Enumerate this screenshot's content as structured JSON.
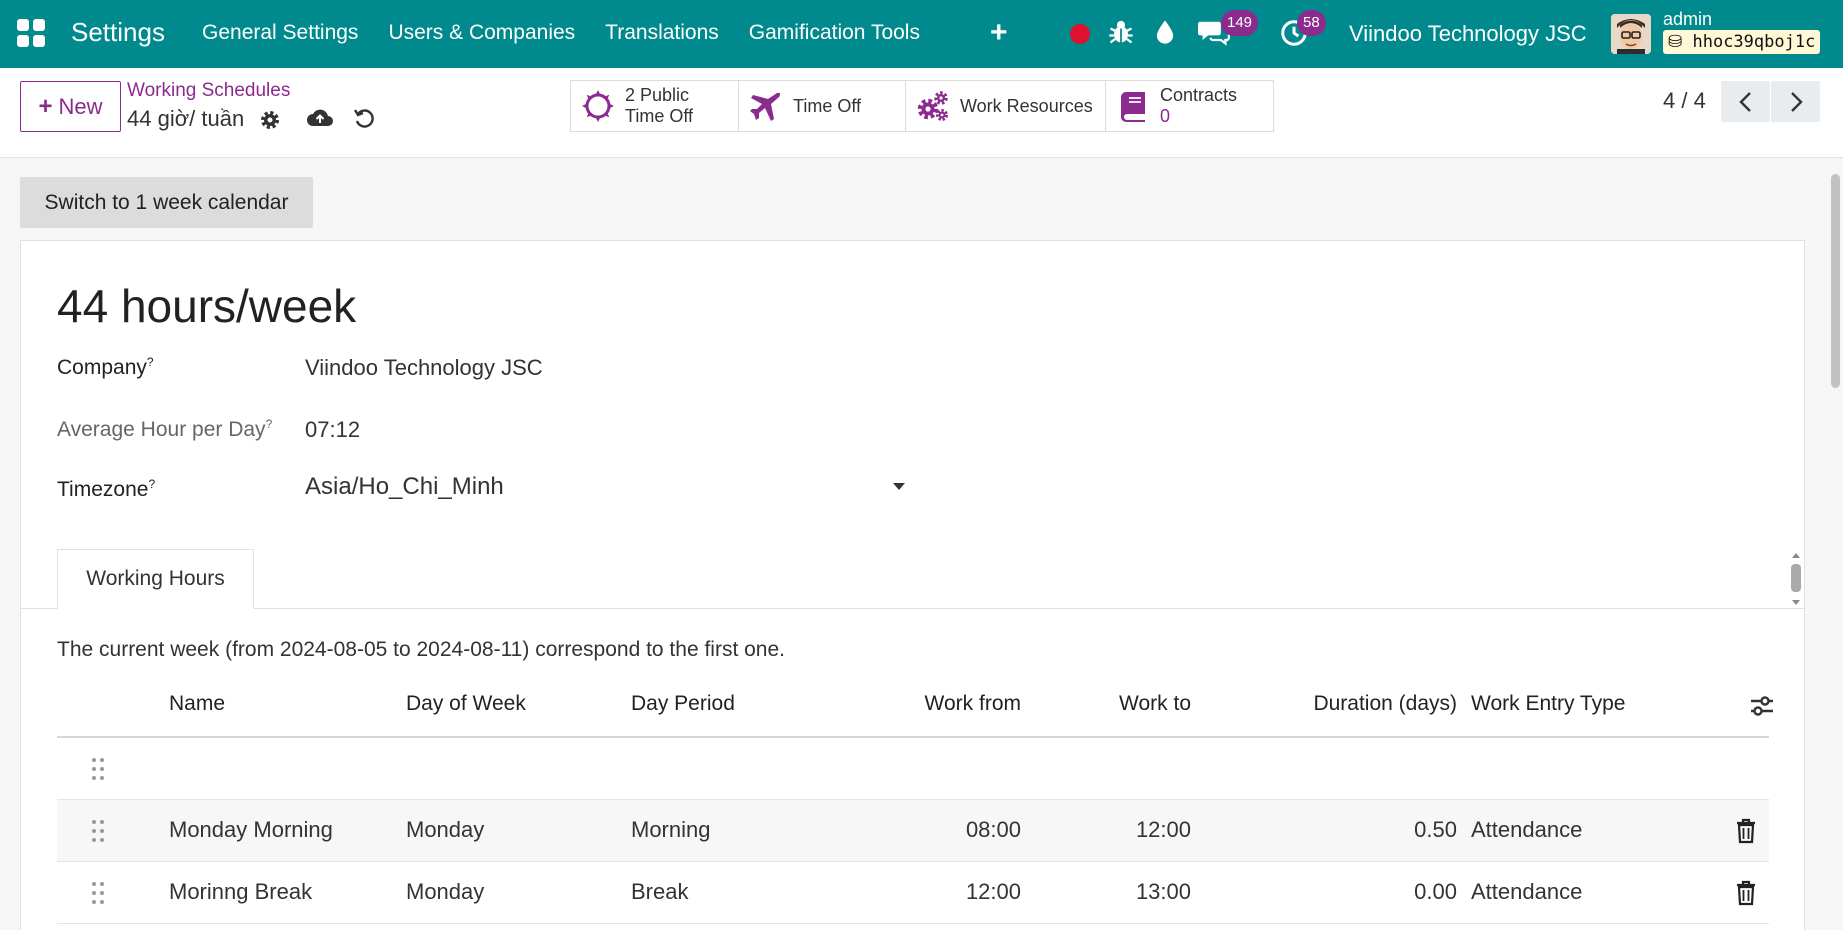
{
  "navbar": {
    "app_title": "Settings",
    "menu": [
      "General Settings",
      "Users & Companies",
      "Translations",
      "Gamification Tools"
    ],
    "plus_label": "+",
    "messages_badge": "149",
    "activities_badge": "58",
    "company": "Viindoo Technology JSC",
    "user": "admin",
    "database": "hhoc39qboj1c",
    "colors": {
      "bar": "#008a8d",
      "badge": "#8b2b8e",
      "record": "#e0112e"
    }
  },
  "control": {
    "new_label": "New",
    "breadcrumb": "Working Schedules",
    "record_name": "44 giờ/ tuần",
    "smart_buttons": [
      {
        "icon": "sun-icon",
        "line1": "2 Public",
        "line2": "Time Off"
      },
      {
        "icon": "plane-icon",
        "label": "Time Off"
      },
      {
        "icon": "gears-icon",
        "label": "Work Resources"
      },
      {
        "icon": "book-icon",
        "label": "Contracts",
        "value": "0"
      }
    ],
    "pager": "4 / 4"
  },
  "form": {
    "switch_button": "Switch to 1 week calendar",
    "title": "44 hours/week",
    "company_label": "Company",
    "company_value": "Viindoo Technology JSC",
    "avg_label": "Average Hour per Day",
    "avg_value": "07:12",
    "tz_label": "Timezone",
    "tz_value": "Asia/Ho_Chi_Minh",
    "help_mark": "?",
    "tab": "Working Hours",
    "week_note": "The current week (from 2024-08-05 to 2024-08-11) correspond to the first one."
  },
  "table": {
    "headers": [
      "Name",
      "Day of Week",
      "Day Period",
      "Work from",
      "Work to",
      "Duration (days)",
      "Work Entry Type"
    ],
    "rows": [
      {
        "name": "Monday Morning",
        "day": "Monday",
        "period": "Morning",
        "from": "08:00",
        "to": "12:00",
        "duration": "0.50",
        "type": "Attendance"
      },
      {
        "name": "Morinng Break",
        "day": "Monday",
        "period": "Break",
        "from": "12:00",
        "to": "13:00",
        "duration": "0.00",
        "type": "Attendance"
      }
    ]
  }
}
